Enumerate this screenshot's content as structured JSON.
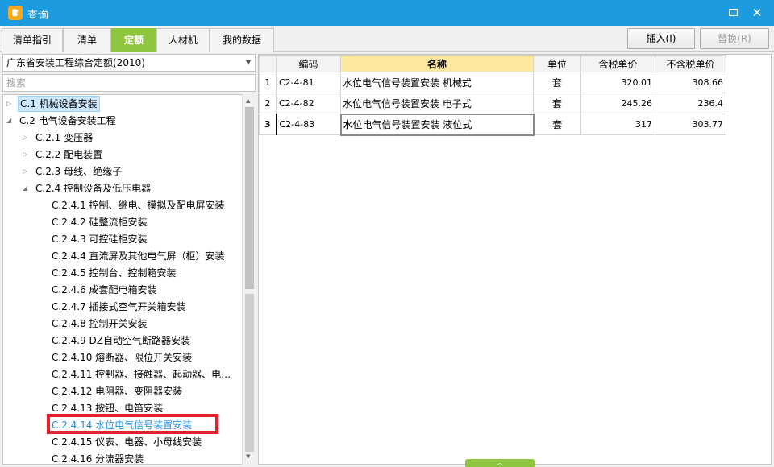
{
  "window": {
    "title": "查询",
    "maximize_label": "",
    "close_label": "✕"
  },
  "tabs": [
    {
      "label": "清单指引",
      "active": false
    },
    {
      "label": "清单",
      "active": false
    },
    {
      "label": "定额",
      "active": true
    },
    {
      "label": "人材机",
      "active": false
    },
    {
      "label": "我的数据",
      "active": false
    }
  ],
  "toolbar": {
    "insert_label": "插入(I)",
    "replace_label": "替换(R)"
  },
  "left": {
    "quota_library": "广东省安装工程综合定额(2010)",
    "search_placeholder": "搜索",
    "tree": [
      {
        "label": "C.1 机械设备安装",
        "level": 0,
        "expander": "▷",
        "state": "selected"
      },
      {
        "label": "C.2 电气设备安装工程",
        "level": 0,
        "expander": "◢",
        "state": ""
      },
      {
        "label": "C.2.1 变压器",
        "level": 1,
        "expander": "▷",
        "state": ""
      },
      {
        "label": "C.2.2 配电装置",
        "level": 1,
        "expander": "▷",
        "state": ""
      },
      {
        "label": "C.2.3 母线、绝缘子",
        "level": 1,
        "expander": "▷",
        "state": ""
      },
      {
        "label": "C.2.4 控制设备及低压电器",
        "level": 1,
        "expander": "◢",
        "state": ""
      },
      {
        "label": "C.2.4.1 控制、继电、模拟及配电屏安装",
        "level": 2,
        "expander": "",
        "state": ""
      },
      {
        "label": "C.2.4.2 硅整流柜安装",
        "level": 2,
        "expander": "",
        "state": ""
      },
      {
        "label": "C.2.4.3 可控硅柜安装",
        "level": 2,
        "expander": "",
        "state": ""
      },
      {
        "label": "C.2.4.4 直流屏及其他电气屏（柜）安装",
        "level": 2,
        "expander": "",
        "state": ""
      },
      {
        "label": "C.2.4.5 控制台、控制箱安装",
        "level": 2,
        "expander": "",
        "state": ""
      },
      {
        "label": "C.2.4.6 成套配电箱安装",
        "level": 2,
        "expander": "",
        "state": ""
      },
      {
        "label": "C.2.4.7 插接式空气开关箱安装",
        "level": 2,
        "expander": "",
        "state": ""
      },
      {
        "label": "C.2.4.8 控制开关安装",
        "level": 2,
        "expander": "",
        "state": ""
      },
      {
        "label": "C.2.4.9 DZ自动空气断路器安装",
        "level": 2,
        "expander": "",
        "state": ""
      },
      {
        "label": "C.2.4.10 熔断器、限位开关安装",
        "level": 2,
        "expander": "",
        "state": ""
      },
      {
        "label": "C.2.4.11 控制器、接触器、起动器、电…",
        "level": 2,
        "expander": "",
        "state": ""
      },
      {
        "label": "C.2.4.12 电阻器、变阻器安装",
        "level": 2,
        "expander": "",
        "state": ""
      },
      {
        "label": "C.2.4.13 按钮、电笛安装",
        "level": 2,
        "expander": "",
        "state": ""
      },
      {
        "label": "C.2.4.14 水位电气信号装置安装",
        "level": 2,
        "expander": "",
        "state": "current"
      },
      {
        "label": "C.2.4.15 仪表、电器、小母线安装",
        "level": 2,
        "expander": "",
        "state": ""
      },
      {
        "label": "C.2.4.16 分流器安装",
        "level": 2,
        "expander": "",
        "state": ""
      }
    ]
  },
  "grid": {
    "columns": [
      "",
      "编码",
      "名称",
      "单位",
      "含税单价",
      "不含税单价"
    ],
    "rows": [
      {
        "no": "1",
        "code": "C2-4-81",
        "name": "水位电气信号装置安装 机械式",
        "unit": "套",
        "price_tax": "320.01",
        "price_notax": "308.66"
      },
      {
        "no": "2",
        "code": "C2-4-82",
        "name": "水位电气信号装置安装 电子式",
        "unit": "套",
        "price_tax": "245.26",
        "price_notax": "236.4"
      },
      {
        "no": "3",
        "code": "C2-4-83",
        "name": "水位电气信号装置安装 液位式",
        "unit": "套",
        "price_tax": "317",
        "price_notax": "303.77"
      }
    ],
    "current_row": 2
  },
  "colors": {
    "titlebar": "#1e9be0",
    "active_tab": "#8fc63f",
    "highlight_header": "#fce89e",
    "current_node_text": "#1e8fe0",
    "annotation_box": "#e8202a"
  }
}
